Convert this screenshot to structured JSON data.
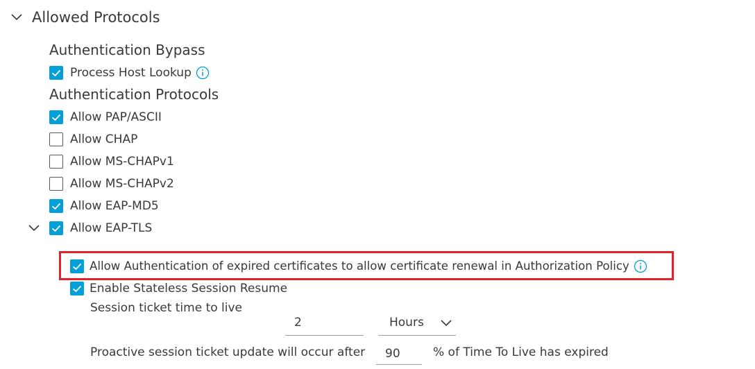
{
  "section": {
    "title": "Allowed Protocols",
    "chevron_icon": "chevron-down-icon"
  },
  "bypass": {
    "heading": "Authentication Bypass",
    "items": [
      {
        "label": "Process Host Lookup",
        "checked": true,
        "has_info": true
      }
    ]
  },
  "protocols": {
    "heading": "Authentication Protocols",
    "items": [
      {
        "label": "Allow PAP/ASCII",
        "checked": true
      },
      {
        "label": "Allow CHAP",
        "checked": false
      },
      {
        "label": "Allow MS-CHAPv1",
        "checked": false
      },
      {
        "label": "Allow MS-CHAPv2",
        "checked": false
      },
      {
        "label": "Allow EAP-MD5",
        "checked": true
      },
      {
        "label": "Allow EAP-TLS",
        "checked": true,
        "expanded": true
      }
    ]
  },
  "eap_tls": {
    "expired_certs": {
      "label": "Allow Authentication of expired certificates to allow certificate renewal in Authorization Policy",
      "checked": true,
      "highlighted": true
    },
    "stateless_resume": {
      "label": "Enable Stateless Session Resume",
      "checked": true
    },
    "ticket_ttl": {
      "label": "Session ticket time to live",
      "value": "2",
      "unit": "Hours"
    },
    "proactive_update": {
      "label": "Proactive session ticket update will occur after",
      "value": "90",
      "suffix": "% of Time To Live has expired"
    }
  },
  "colors": {
    "checkbox_checked": "#049fd9",
    "highlight_border": "#e3202b",
    "text": "#39393b",
    "info_icon": "#049fd9"
  }
}
